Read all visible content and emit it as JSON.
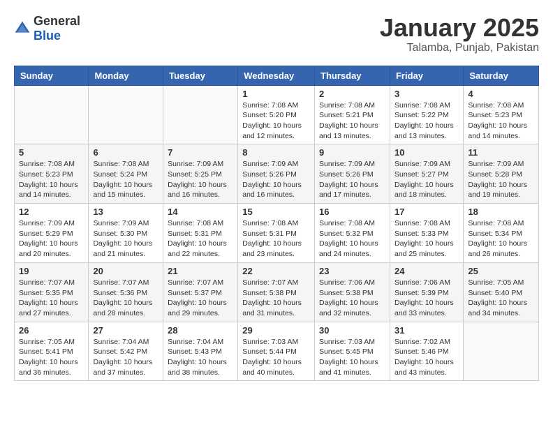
{
  "header": {
    "logo_general": "General",
    "logo_blue": "Blue",
    "month": "January 2025",
    "location": "Talamba, Punjab, Pakistan"
  },
  "days": [
    "Sunday",
    "Monday",
    "Tuesday",
    "Wednesday",
    "Thursday",
    "Friday",
    "Saturday"
  ],
  "weeks": [
    [
      {
        "date": "",
        "sunrise": "",
        "sunset": "",
        "daylight": ""
      },
      {
        "date": "",
        "sunrise": "",
        "sunset": "",
        "daylight": ""
      },
      {
        "date": "",
        "sunrise": "",
        "sunset": "",
        "daylight": ""
      },
      {
        "date": "1",
        "sunrise": "Sunrise: 7:08 AM",
        "sunset": "Sunset: 5:20 PM",
        "daylight": "Daylight: 10 hours and 12 minutes."
      },
      {
        "date": "2",
        "sunrise": "Sunrise: 7:08 AM",
        "sunset": "Sunset: 5:21 PM",
        "daylight": "Daylight: 10 hours and 13 minutes."
      },
      {
        "date": "3",
        "sunrise": "Sunrise: 7:08 AM",
        "sunset": "Sunset: 5:22 PM",
        "daylight": "Daylight: 10 hours and 13 minutes."
      },
      {
        "date": "4",
        "sunrise": "Sunrise: 7:08 AM",
        "sunset": "Sunset: 5:23 PM",
        "daylight": "Daylight: 10 hours and 14 minutes."
      }
    ],
    [
      {
        "date": "5",
        "sunrise": "Sunrise: 7:08 AM",
        "sunset": "Sunset: 5:23 PM",
        "daylight": "Daylight: 10 hours and 14 minutes."
      },
      {
        "date": "6",
        "sunrise": "Sunrise: 7:08 AM",
        "sunset": "Sunset: 5:24 PM",
        "daylight": "Daylight: 10 hours and 15 minutes."
      },
      {
        "date": "7",
        "sunrise": "Sunrise: 7:09 AM",
        "sunset": "Sunset: 5:25 PM",
        "daylight": "Daylight: 10 hours and 16 minutes."
      },
      {
        "date": "8",
        "sunrise": "Sunrise: 7:09 AM",
        "sunset": "Sunset: 5:26 PM",
        "daylight": "Daylight: 10 hours and 16 minutes."
      },
      {
        "date": "9",
        "sunrise": "Sunrise: 7:09 AM",
        "sunset": "Sunset: 5:26 PM",
        "daylight": "Daylight: 10 hours and 17 minutes."
      },
      {
        "date": "10",
        "sunrise": "Sunrise: 7:09 AM",
        "sunset": "Sunset: 5:27 PM",
        "daylight": "Daylight: 10 hours and 18 minutes."
      },
      {
        "date": "11",
        "sunrise": "Sunrise: 7:09 AM",
        "sunset": "Sunset: 5:28 PM",
        "daylight": "Daylight: 10 hours and 19 minutes."
      }
    ],
    [
      {
        "date": "12",
        "sunrise": "Sunrise: 7:09 AM",
        "sunset": "Sunset: 5:29 PM",
        "daylight": "Daylight: 10 hours and 20 minutes."
      },
      {
        "date": "13",
        "sunrise": "Sunrise: 7:09 AM",
        "sunset": "Sunset: 5:30 PM",
        "daylight": "Daylight: 10 hours and 21 minutes."
      },
      {
        "date": "14",
        "sunrise": "Sunrise: 7:08 AM",
        "sunset": "Sunset: 5:31 PM",
        "daylight": "Daylight: 10 hours and 22 minutes."
      },
      {
        "date": "15",
        "sunrise": "Sunrise: 7:08 AM",
        "sunset": "Sunset: 5:31 PM",
        "daylight": "Daylight: 10 hours and 23 minutes."
      },
      {
        "date": "16",
        "sunrise": "Sunrise: 7:08 AM",
        "sunset": "Sunset: 5:32 PM",
        "daylight": "Daylight: 10 hours and 24 minutes."
      },
      {
        "date": "17",
        "sunrise": "Sunrise: 7:08 AM",
        "sunset": "Sunset: 5:33 PM",
        "daylight": "Daylight: 10 hours and 25 minutes."
      },
      {
        "date": "18",
        "sunrise": "Sunrise: 7:08 AM",
        "sunset": "Sunset: 5:34 PM",
        "daylight": "Daylight: 10 hours and 26 minutes."
      }
    ],
    [
      {
        "date": "19",
        "sunrise": "Sunrise: 7:07 AM",
        "sunset": "Sunset: 5:35 PM",
        "daylight": "Daylight: 10 hours and 27 minutes."
      },
      {
        "date": "20",
        "sunrise": "Sunrise: 7:07 AM",
        "sunset": "Sunset: 5:36 PM",
        "daylight": "Daylight: 10 hours and 28 minutes."
      },
      {
        "date": "21",
        "sunrise": "Sunrise: 7:07 AM",
        "sunset": "Sunset: 5:37 PM",
        "daylight": "Daylight: 10 hours and 29 minutes."
      },
      {
        "date": "22",
        "sunrise": "Sunrise: 7:07 AM",
        "sunset": "Sunset: 5:38 PM",
        "daylight": "Daylight: 10 hours and 31 minutes."
      },
      {
        "date": "23",
        "sunrise": "Sunrise: 7:06 AM",
        "sunset": "Sunset: 5:38 PM",
        "daylight": "Daylight: 10 hours and 32 minutes."
      },
      {
        "date": "24",
        "sunrise": "Sunrise: 7:06 AM",
        "sunset": "Sunset: 5:39 PM",
        "daylight": "Daylight: 10 hours and 33 minutes."
      },
      {
        "date": "25",
        "sunrise": "Sunrise: 7:05 AM",
        "sunset": "Sunset: 5:40 PM",
        "daylight": "Daylight: 10 hours and 34 minutes."
      }
    ],
    [
      {
        "date": "26",
        "sunrise": "Sunrise: 7:05 AM",
        "sunset": "Sunset: 5:41 PM",
        "daylight": "Daylight: 10 hours and 36 minutes."
      },
      {
        "date": "27",
        "sunrise": "Sunrise: 7:04 AM",
        "sunset": "Sunset: 5:42 PM",
        "daylight": "Daylight: 10 hours and 37 minutes."
      },
      {
        "date": "28",
        "sunrise": "Sunrise: 7:04 AM",
        "sunset": "Sunset: 5:43 PM",
        "daylight": "Daylight: 10 hours and 38 minutes."
      },
      {
        "date": "29",
        "sunrise": "Sunrise: 7:03 AM",
        "sunset": "Sunset: 5:44 PM",
        "daylight": "Daylight: 10 hours and 40 minutes."
      },
      {
        "date": "30",
        "sunrise": "Sunrise: 7:03 AM",
        "sunset": "Sunset: 5:45 PM",
        "daylight": "Daylight: 10 hours and 41 minutes."
      },
      {
        "date": "31",
        "sunrise": "Sunrise: 7:02 AM",
        "sunset": "Sunset: 5:46 PM",
        "daylight": "Daylight: 10 hours and 43 minutes."
      },
      {
        "date": "",
        "sunrise": "",
        "sunset": "",
        "daylight": ""
      }
    ]
  ]
}
